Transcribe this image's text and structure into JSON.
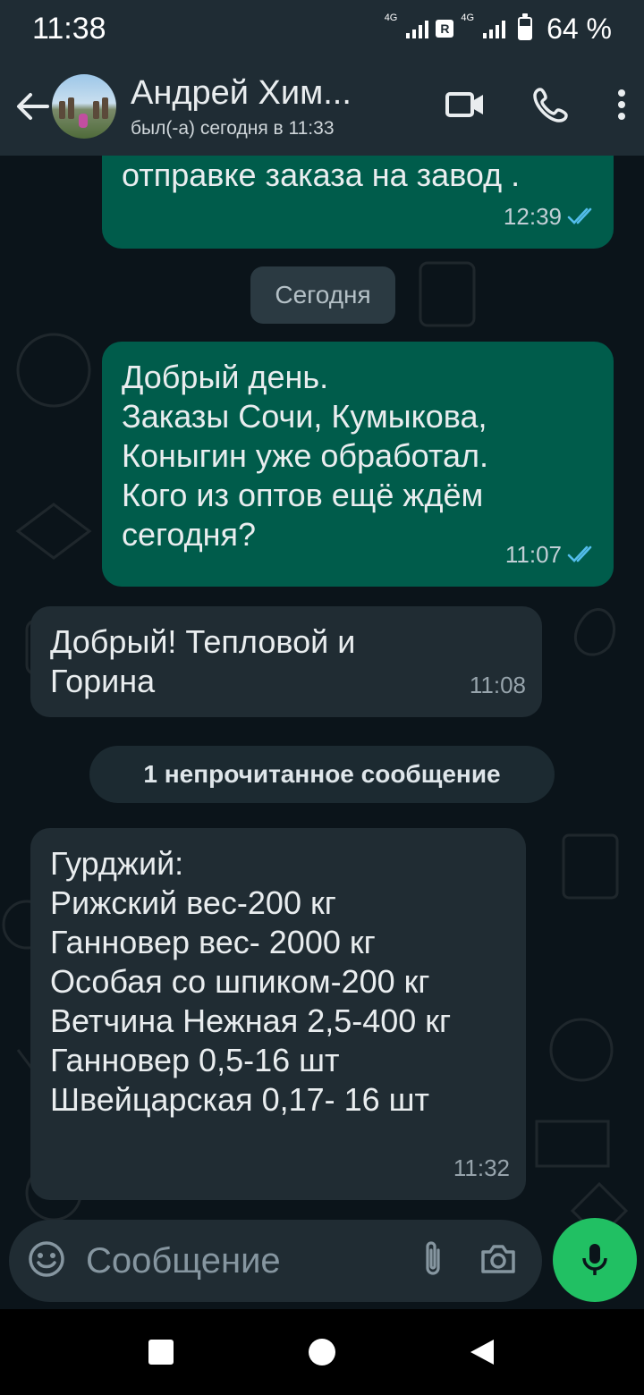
{
  "status_bar": {
    "time": "11:38",
    "net1": "4G",
    "roaming": "R",
    "net2": "4G",
    "battery": "64 %"
  },
  "header": {
    "contact_name": "Андрей Хим...",
    "last_seen": "был(-а) сегодня в 11:33",
    "icons": [
      "back-arrow-icon",
      "video-call-icon",
      "phone-icon",
      "more-vert-icon"
    ]
  },
  "messages": [
    {
      "direction": "out",
      "text": "отправке заказа на завод .",
      "time": "12:39",
      "status": "read"
    },
    {
      "direction": "out",
      "text": "Добрый день.\nЗаказы Сочи, Кумыкова,\nКоныгин уже обработал.\nКого из оптов ещё ждём\nсегодня?",
      "time": "11:07",
      "status": "read"
    },
    {
      "direction": "in",
      "text": "Добрый! Тепловой и\nГорина",
      "time": "11:08"
    },
    {
      "direction": "in",
      "text": "Гурджий:\nРижский вес-200 кг\nГанновер вес- 2000 кг\nОсобая со шпиком-200 кг\nВетчина Нежная 2,5-400 кг\nГанновер 0,5-16 шт\nШвейцарская 0,17- 16 шт",
      "time": "11:32"
    }
  ],
  "chips": {
    "day": "Сегодня",
    "unread": "1 непрочитанное сообщение"
  },
  "composer": {
    "placeholder": "Сообщение"
  },
  "colors": {
    "outgoing_bubble": "#005c4b",
    "incoming_bubble": "#202c33",
    "mic_button": "#21c063",
    "read_ticks": "#53bdeb"
  }
}
